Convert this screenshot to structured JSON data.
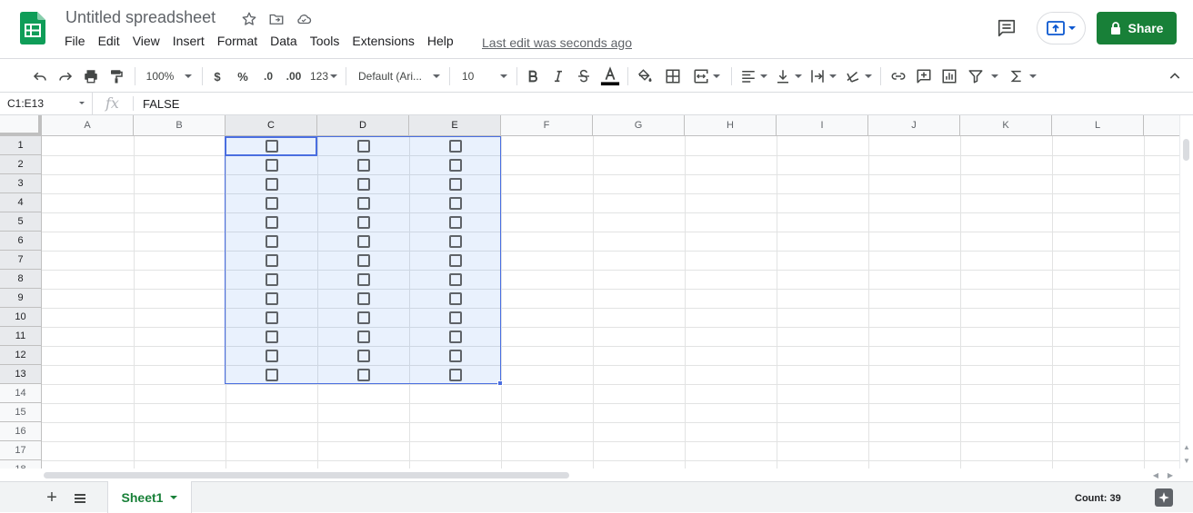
{
  "app": {
    "title": "Untitled spreadsheet",
    "menu": [
      "File",
      "Edit",
      "View",
      "Insert",
      "Format",
      "Data",
      "Tools",
      "Extensions",
      "Help"
    ],
    "last_edit": "Last edit was seconds ago",
    "share_label": "Share",
    "brand_color": "#188038"
  },
  "toolbar": {
    "zoom": "100%",
    "currency": "$",
    "percent": "%",
    "decimal_decrease": ".0",
    "decimal_increase": ".00",
    "number_format": "123",
    "font": "Default (Ari...",
    "font_size": "10"
  },
  "formula_bar": {
    "name_box": "C1:E13",
    "fx_label": "fx",
    "value": "FALSE"
  },
  "grid": {
    "columns": [
      "A",
      "B",
      "C",
      "D",
      "E",
      "F",
      "G",
      "H",
      "I",
      "J",
      "K",
      "L"
    ],
    "rows": [
      "1",
      "2",
      "3",
      "4",
      "5",
      "6",
      "7",
      "8",
      "9",
      "10",
      "11",
      "12",
      "13",
      "14",
      "15",
      "16",
      "17",
      "18"
    ],
    "selected_columns": [
      "C",
      "D",
      "E"
    ],
    "selected_rows_count": 13,
    "checkbox_columns": [
      "C",
      "D",
      "E"
    ],
    "checkbox_rows_count": 13,
    "checkbox_value": false,
    "selection_color": "#4a6ee0"
  },
  "sheets": {
    "add_label": "+",
    "active": "Sheet1"
  },
  "status": {
    "count": "Count: 39"
  }
}
